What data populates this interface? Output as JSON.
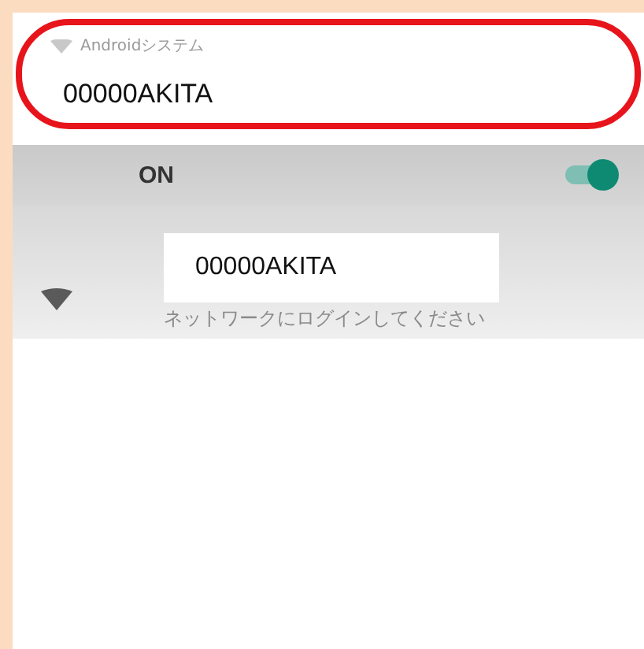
{
  "notification": {
    "app_name": "Androidシステム",
    "network_name": "00000AKITA"
  },
  "wifi_switch": {
    "label": "ON",
    "on": true
  },
  "network": {
    "name": "00000AKITA",
    "status": "ネットワークにログインしてください"
  }
}
